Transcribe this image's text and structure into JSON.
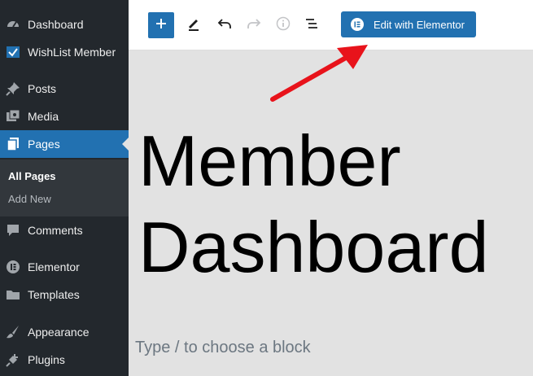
{
  "sidebar": {
    "items": [
      {
        "label": "Dashboard",
        "icon": "dashboard-icon"
      },
      {
        "label": "WishList Member",
        "icon": "wishlist-icon"
      },
      {
        "label": "Posts",
        "icon": "pin-icon"
      },
      {
        "label": "Media",
        "icon": "media-icon"
      },
      {
        "label": "Pages",
        "icon": "pages-icon",
        "active": true
      },
      {
        "label": "Comments",
        "icon": "comment-icon"
      },
      {
        "label": "Elementor",
        "icon": "elementor-icon"
      },
      {
        "label": "Templates",
        "icon": "folder-icon"
      },
      {
        "label": "Appearance",
        "icon": "brush-icon"
      },
      {
        "label": "Plugins",
        "icon": "plug-icon"
      }
    ],
    "submenu": [
      {
        "label": "All Pages",
        "current": true
      },
      {
        "label": "Add New",
        "current": false
      }
    ]
  },
  "toolbar": {
    "edit_with_elementor_label": "Edit with Elementor"
  },
  "editor": {
    "title": "Member Dashboard",
    "block_placeholder": "Type / to choose a block"
  },
  "colors": {
    "sidebar_bg": "#23282d",
    "accent": "#2271b1",
    "annotation_arrow": "#e8131b"
  }
}
